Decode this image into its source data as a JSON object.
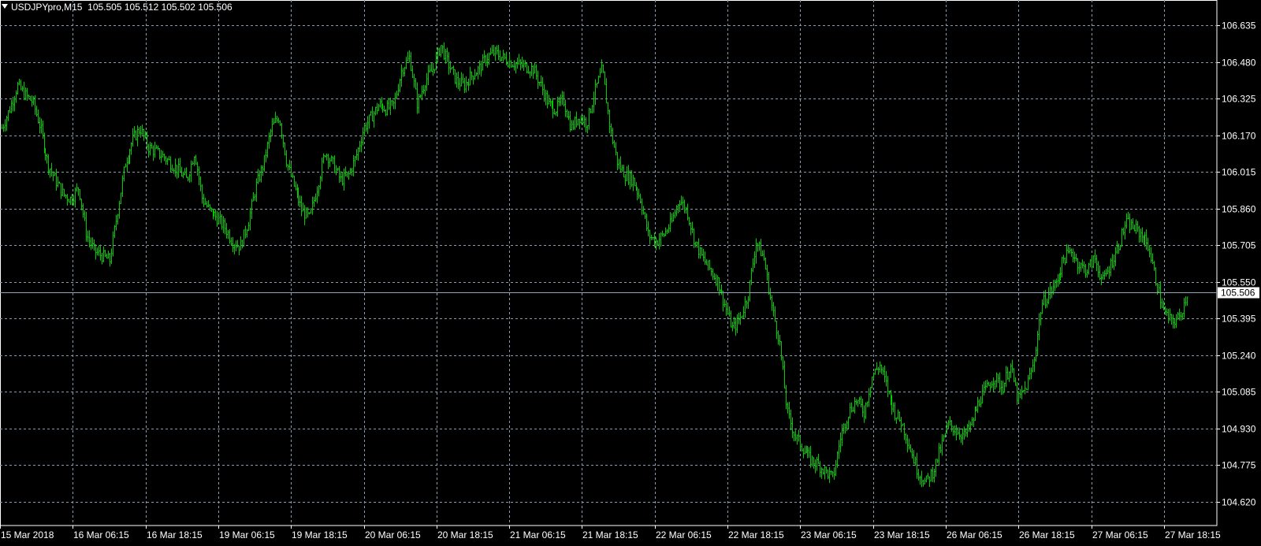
{
  "header": {
    "symbol": "USDJPYpro,M15",
    "ohlc": "105.505 105.512 105.502 105.506"
  },
  "colors": {
    "background": "#000000",
    "grid": "#8a9bb0",
    "axis": "#ffffff",
    "bars": "#00cc00",
    "bid_line": "#8fa4bd"
  },
  "chart_data": {
    "type": "line",
    "style": "ohlc-bars",
    "grid": true,
    "yticks": [
      "106.635",
      "106.480",
      "106.325",
      "106.170",
      "106.015",
      "105.860",
      "105.705",
      "105.550",
      "105.395",
      "105.240",
      "105.085",
      "104.930",
      "104.775",
      "104.620"
    ],
    "xticks": [
      "15 Mar 2018",
      "16 Mar 06:15",
      "16 Mar 18:15",
      "19 Mar 06:15",
      "19 Mar 18:15",
      "20 Mar 06:15",
      "20 Mar 18:15",
      "21 Mar 06:15",
      "21 Mar 18:15",
      "22 Mar 06:15",
      "22 Mar 18:15",
      "23 Mar 06:15",
      "23 Mar 18:15",
      "26 Mar 06:15",
      "26 Mar 18:15",
      "27 Mar 06:15",
      "27 Mar 18:15"
    ],
    "ylim": [
      104.59,
      106.69
    ],
    "current_price": "105.506",
    "series": [
      {
        "values": [
          106.2,
          106.28,
          106.38,
          106.34,
          106.31,
          106.2,
          106.05,
          105.98,
          105.92,
          105.9,
          105.95,
          105.75,
          105.68,
          105.66,
          105.64,
          105.85,
          106.05,
          106.15,
          106.2,
          106.12,
          106.1,
          106.08,
          106.05,
          106.02,
          105.98,
          106.1,
          105.9,
          105.85,
          105.82,
          105.78,
          105.72,
          105.7,
          105.8,
          105.95,
          106.05,
          106.2,
          106.25,
          106.05,
          105.95,
          105.85,
          105.82,
          105.95,
          106.1,
          106.05,
          105.98,
          106.0,
          106.08,
          106.2,
          106.25,
          106.3,
          106.28,
          106.3,
          106.45,
          106.5,
          106.3,
          106.4,
          106.45,
          106.55,
          106.47,
          106.4,
          106.38,
          106.42,
          106.45,
          106.5,
          106.52,
          106.5,
          106.48,
          106.47,
          106.46,
          106.45,
          106.38,
          106.3,
          106.28,
          106.32,
          106.2,
          106.25,
          106.22,
          106.35,
          106.45,
          106.2,
          106.05,
          106.0,
          105.98,
          105.9,
          105.75,
          105.72,
          105.75,
          105.8,
          105.9,
          105.85,
          105.72,
          105.65,
          105.6,
          105.55,
          105.45,
          105.35,
          105.4,
          105.5,
          105.72,
          105.65,
          105.45,
          105.3,
          105.0,
          104.9,
          104.85,
          104.8,
          104.78,
          104.75,
          104.72,
          104.9,
          105.0,
          105.05,
          105.0,
          105.15,
          105.2,
          105.1,
          105.0,
          104.95,
          104.85,
          104.75,
          104.7,
          104.75,
          104.85,
          104.95,
          104.92,
          104.9,
          104.95,
          105.05,
          105.1,
          105.15,
          105.1,
          105.2,
          105.05,
          105.1,
          105.2,
          105.45,
          105.5,
          105.55,
          105.65,
          105.68,
          105.62,
          105.6,
          105.65,
          105.55,
          105.62,
          105.7,
          105.8,
          105.78,
          105.75,
          105.7,
          105.55,
          105.42,
          105.38,
          105.4,
          105.5
        ]
      }
    ]
  }
}
